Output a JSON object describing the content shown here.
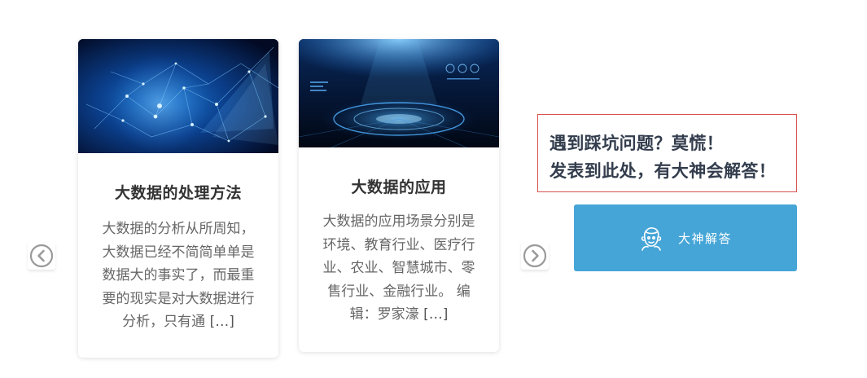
{
  "carousel": {
    "prev_icon": "chevron-left-circle-icon",
    "next_icon": "chevron-right-circle-icon",
    "cards": [
      {
        "image_icon": "network-tech-image",
        "title": "大数据的处理方法",
        "excerpt_lines": [
          "大数据的分析从所周知，",
          "大数据已经不简简单单是",
          "数据大的事实了，而最重",
          "要的现实是对大数据进行",
          "分析，只有通"
        ],
        "more": "[…]"
      },
      {
        "image_icon": "digital-stage-image",
        "title": "大数据的应用",
        "excerpt_lines": [
          "大数据的应用场景分别是",
          "环境、教育行业、医疗行",
          "业、农业、智慧城市、零",
          "售行业、金融行业。 编",
          "辑：罗家濠"
        ],
        "more": "[…]"
      }
    ]
  },
  "notice": {
    "line1": "遇到踩坑问题？莫慌！",
    "line2": "发表到此处，有大神会解答！"
  },
  "ask_button": {
    "label": "大神解答",
    "icon": "expert-avatar-icon"
  },
  "colors": {
    "button_bg": "#45a5d7",
    "notice_border": "#d9534f",
    "arrow_gray": "#9a9a9a"
  }
}
